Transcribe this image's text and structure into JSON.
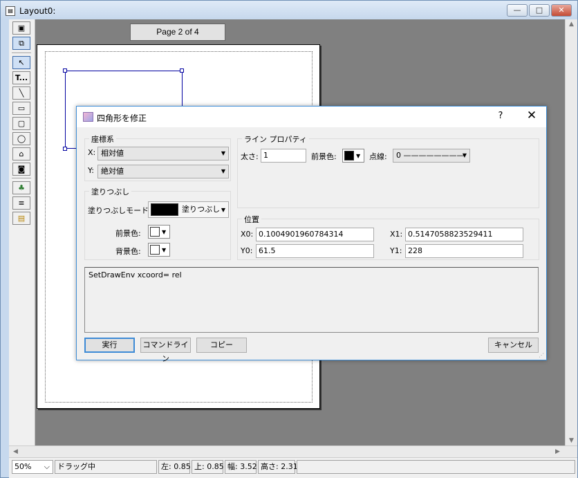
{
  "window": {
    "title": "Layout0:",
    "minimize_glyph": "—",
    "maximize_glyph": "□",
    "close_glyph": "✕"
  },
  "page_indicator": "Page 2 of 4",
  "toolbar": {
    "tools": [
      {
        "name": "pointer-tool",
        "glyph": "↖"
      },
      {
        "name": "text-tool",
        "glyph": "T..."
      },
      {
        "name": "line-tool",
        "glyph": "╲"
      },
      {
        "name": "rectangle-tool",
        "glyph": "▭"
      },
      {
        "name": "rounded-rectangle-tool",
        "glyph": "▢"
      },
      {
        "name": "ellipse-tool",
        "glyph": "◯"
      },
      {
        "name": "polygon-tool",
        "glyph": "⌂"
      },
      {
        "name": "image-tool",
        "glyph": "◙"
      },
      {
        "name": "tree-tool",
        "glyph": "♣"
      },
      {
        "name": "layer-tool",
        "glyph": "≡"
      },
      {
        "name": "export-tool",
        "glyph": "▤"
      }
    ]
  },
  "statusbar": {
    "zoom": "50%",
    "zoom_arrow": "⌵",
    "mode": "ドラッグ中",
    "left": "左: 0.85",
    "top": "上: 0.85",
    "width": "幅: 3.52",
    "height": "高さ: 2.31"
  },
  "dialog": {
    "title": "四角形を修正",
    "help": "?",
    "close": "✕",
    "coord_group": {
      "label": "座標系",
      "x_label": "X:",
      "x_value": "相対値",
      "y_label": "Y:",
      "y_value": "絶対値"
    },
    "line_group": {
      "label": "ライン プロパティ",
      "thickness_label": "太さ:",
      "thickness_value": "1",
      "fg_label": "前景色:",
      "fg_color": "#000000",
      "dash_label": "点線:",
      "dash_value": "0 ————————"
    },
    "fill_group": {
      "label": "塗りつぶし",
      "mode_label": "塗りつぶしモード:",
      "mode_value": "塗りつぶし",
      "mode_swatch": "#000000",
      "fg_label": "前景色:",
      "fg_color": "#ffffff",
      "bg_label": "背景色:",
      "bg_color": "#ffffff"
    },
    "position_group": {
      "label": "位置",
      "x0_label": "X0:",
      "x0_value": "0.1004901960784314",
      "x1_label": "X1:",
      "x1_value": "0.5147058823529411",
      "y0_label": "Y0:",
      "y0_value": "61.5",
      "y1_label": "Y1:",
      "y1_value": "228"
    },
    "command_text": "SetDrawEnv xcoord= rel",
    "buttons": {
      "execute": "実行",
      "command_line": "コマンドライン",
      "copy": "コピー",
      "cancel": "キャンセル"
    }
  },
  "colors": {
    "selection": "#0000a0",
    "canvas": "#808080",
    "accent": "#3c8ad6"
  }
}
